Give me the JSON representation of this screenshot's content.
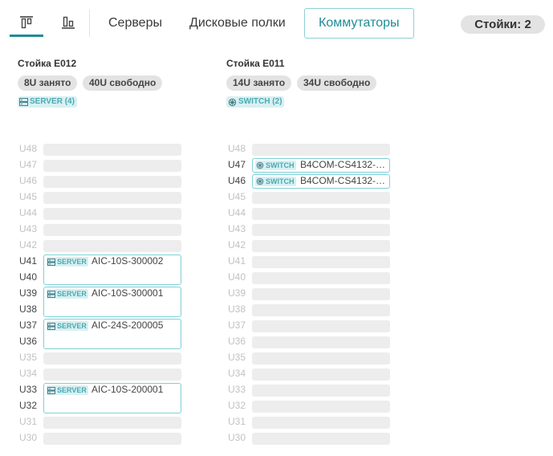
{
  "toolbar": {
    "tabs": [
      {
        "label": "Серверы"
      },
      {
        "label": "Дисковые полки"
      },
      {
        "label": "Коммутаторы",
        "active": true
      }
    ],
    "racks_count": "Стойки: 2",
    "accent_color": "#1f8c96"
  },
  "racks": [
    {
      "title": "Стойка E012",
      "occupied": "8U занято",
      "free": "40U свободно",
      "type_badge": "SERVER (4)",
      "units": [
        "U48",
        "U47",
        "U46",
        "U45",
        "U44",
        "U43",
        "U42",
        "U41",
        "U40",
        "U39",
        "U38",
        "U37",
        "U36",
        "U35",
        "U34",
        "U33",
        "U32",
        "U31",
        "U30"
      ],
      "occupied_units": [
        "U41",
        "U40",
        "U39",
        "U38",
        "U37",
        "U36",
        "U33",
        "U32"
      ],
      "devices": [
        {
          "type": "SERVER",
          "name": "AIC-10S-300002",
          "top_unit": "U41",
          "size": 2
        },
        {
          "type": "SERVER",
          "name": "AIC-10S-300001",
          "top_unit": "U39",
          "size": 2
        },
        {
          "type": "SERVER",
          "name": "AIC-24S-200005",
          "top_unit": "U37",
          "size": 2
        },
        {
          "type": "SERVER",
          "name": "AIC-10S-200001",
          "top_unit": "U33",
          "size": 2
        }
      ]
    },
    {
      "title": "Стойка E011",
      "occupied": "14U занято",
      "free": "34U свободно",
      "type_badge": "SWITCH (2)",
      "units": [
        "U48",
        "U47",
        "U46",
        "U45",
        "U44",
        "U43",
        "U42",
        "U41",
        "U40",
        "U39",
        "U38",
        "U37",
        "U36",
        "U35",
        "U34",
        "U33",
        "U32",
        "U31",
        "U30"
      ],
      "occupied_units": [
        "U47",
        "U46"
      ],
      "devices": [
        {
          "type": "SWITCH",
          "name": "B4COM-CS4132-5…",
          "top_unit": "U47",
          "size": 1
        },
        {
          "type": "SWITCH",
          "name": "B4COM-CS4132-5…",
          "top_unit": "U46",
          "size": 1
        }
      ]
    }
  ]
}
